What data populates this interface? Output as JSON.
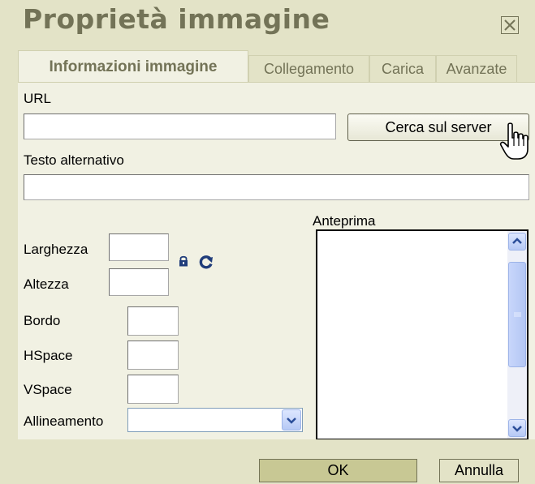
{
  "dialog": {
    "title": "Proprietà immagine",
    "close_icon": "close-icon"
  },
  "tabs": [
    {
      "label": "Informazioni immagine",
      "active": true
    },
    {
      "label": "Collegamento",
      "active": false
    },
    {
      "label": "Carica",
      "active": false
    },
    {
      "label": "Avanzate",
      "active": false
    }
  ],
  "form": {
    "url_label": "URL",
    "url_value": "",
    "browse_server_label": "Cerca sul server",
    "alt_label": "Testo alternativo",
    "alt_value": "",
    "width_label": "Larghezza",
    "width_value": "",
    "height_label": "Altezza",
    "height_value": "",
    "lock_icon": "lock-icon",
    "reset_icon": "refresh-icon",
    "border_label": "Bordo",
    "border_value": "",
    "hspace_label": "HSpace",
    "hspace_value": "",
    "vspace_label": "VSpace",
    "vspace_value": "",
    "align_label": "Allineamento",
    "align_value": "",
    "preview_label": "Anteprima"
  },
  "footer": {
    "ok_label": "OK",
    "cancel_label": "Annulla"
  },
  "colors": {
    "dialog_bg": "#e3e3c7",
    "panel_bg": "#f1f1e3",
    "title_text": "#737357",
    "ok_bg": "#c8c894"
  }
}
